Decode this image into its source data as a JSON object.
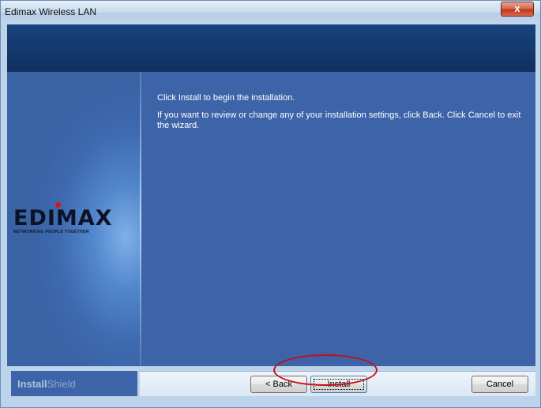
{
  "window": {
    "title": "Edimax Wireless LAN",
    "close_glyph": "x"
  },
  "logo": {
    "wordmark": "EDIMAX",
    "tagline": "NETWORKING PEOPLE TOGETHER"
  },
  "content": {
    "line1": "Click Install to begin the installation.",
    "line2": "If you want to review or change any of your installation settings, click Back. Click Cancel to exit the wizard."
  },
  "footer": {
    "brand_bold": "Install",
    "brand_light": "Shield",
    "back_label": "< Back",
    "install_label": "Install",
    "cancel_label": "Cancel"
  },
  "colors": {
    "panel": "#3d64a8",
    "header": "#102f5d",
    "highlight": "#c0101a"
  }
}
